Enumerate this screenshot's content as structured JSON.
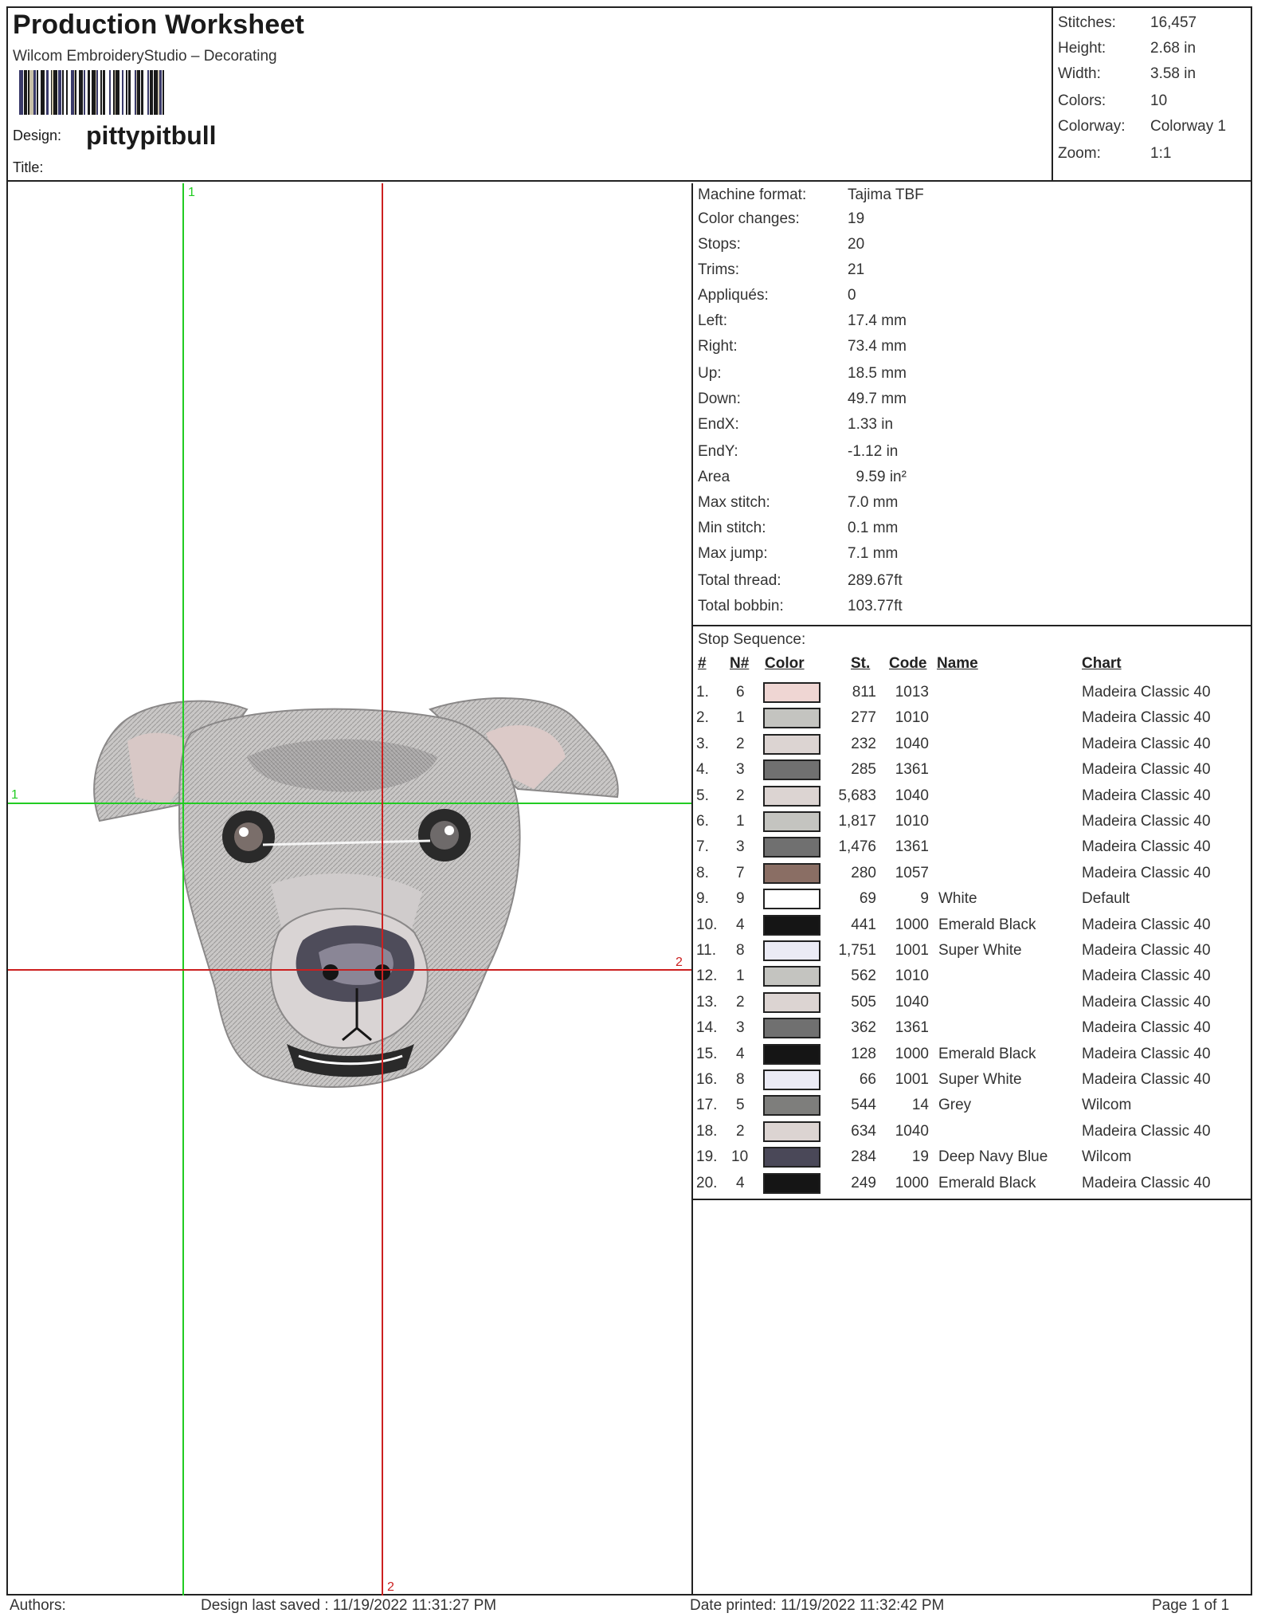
{
  "header": {
    "title": "Production Worksheet",
    "subtitle": "Wilcom EmbroideryStudio – Decorating",
    "design_label": "Design:",
    "design_name": "pittypitbull",
    "title_label": "Title:"
  },
  "summary": [
    {
      "label": "Stitches:",
      "value": "16,457"
    },
    {
      "label": "Height:",
      "value": "2.68 in"
    },
    {
      "label": "Width:",
      "value": "3.58 in"
    },
    {
      "label": "Colors:",
      "value": "10"
    },
    {
      "label": "Colorway:",
      "value": "Colorway 1"
    },
    {
      "label": "Zoom:",
      "value": "1:1"
    }
  ],
  "info": [
    {
      "label": "Machine format:",
      "value": "Tajima TBF"
    },
    {
      "label": "Color changes:",
      "value": "19"
    },
    {
      "label": "Stops:",
      "value": "20"
    },
    {
      "label": "Trims:",
      "value": "21"
    },
    {
      "label": "Appliqués:",
      "value": "0"
    },
    {
      "label": "Left:",
      "value": "17.4 mm"
    },
    {
      "label": "Right:",
      "value": "73.4 mm"
    },
    {
      "label": "Up:",
      "value": "18.5 mm"
    },
    {
      "label": "Down:",
      "value": "49.7 mm"
    },
    {
      "label": "EndX:",
      "value": "1.33 in"
    },
    {
      "label": "EndY:",
      "value": "-1.12 in"
    },
    {
      "label": "Area",
      "value": "  9.59 in²"
    },
    {
      "label": "Max stitch:",
      "value": "7.0 mm"
    },
    {
      "label": "Min stitch:",
      "value": "0.1 mm"
    },
    {
      "label": "Max jump:",
      "value": "7.1 mm"
    },
    {
      "label": "Total thread:",
      "value": "289.67ft"
    },
    {
      "label": "Total bobbin:",
      "value": "103.77ft"
    }
  ],
  "sequence": {
    "title": "Stop Sequence:",
    "headers": {
      "num": "#",
      "n": "N#",
      "color": "Color",
      "st": "St.",
      "code": "Code",
      "name": "Name",
      "chart": "Chart"
    },
    "rows": [
      {
        "num": "1.",
        "n": "6",
        "color": "#efd6d3",
        "st": "811",
        "code": "1013",
        "name": "",
        "chart": "Madeira Classic 40"
      },
      {
        "num": "2.",
        "n": "1",
        "color": "#c4c4c0",
        "st": "277",
        "code": "1010",
        "name": "",
        "chart": "Madeira Classic 40"
      },
      {
        "num": "3.",
        "n": "2",
        "color": "#dcd4d2",
        "st": "232",
        "code": "1040",
        "name": "",
        "chart": "Madeira Classic 40"
      },
      {
        "num": "4.",
        "n": "3",
        "color": "#707070",
        "st": "285",
        "code": "1361",
        "name": "",
        "chart": "Madeira Classic 40"
      },
      {
        "num": "5.",
        "n": "2",
        "color": "#dcd4d2",
        "st": "5,683",
        "code": "1040",
        "name": "",
        "chart": "Madeira Classic 40"
      },
      {
        "num": "6.",
        "n": "1",
        "color": "#c4c4c0",
        "st": "1,817",
        "code": "1010",
        "name": "",
        "chart": "Madeira Classic 40"
      },
      {
        "num": "7.",
        "n": "3",
        "color": "#707070",
        "st": "1,476",
        "code": "1361",
        "name": "",
        "chart": "Madeira Classic 40"
      },
      {
        "num": "8.",
        "n": "7",
        "color": "#8a6e64",
        "st": "280",
        "code": "1057",
        "name": "",
        "chart": "Madeira Classic 40"
      },
      {
        "num": "9.",
        "n": "9",
        "color": "#ffffff",
        "st": "69",
        "code": "9",
        "name": "White",
        "chart": "Default"
      },
      {
        "num": "10.",
        "n": "4",
        "color": "#151515",
        "st": "441",
        "code": "1000",
        "name": "Emerald Black",
        "chart": "Madeira Classic 40"
      },
      {
        "num": "11.",
        "n": "8",
        "color": "#ebebf5",
        "st": "1,751",
        "code": "1001",
        "name": "Super White",
        "chart": "Madeira Classic 40"
      },
      {
        "num": "12.",
        "n": "1",
        "color": "#c4c4c0",
        "st": "562",
        "code": "1010",
        "name": "",
        "chart": "Madeira Classic 40"
      },
      {
        "num": "13.",
        "n": "2",
        "color": "#dcd4d2",
        "st": "505",
        "code": "1040",
        "name": "",
        "chart": "Madeira Classic 40"
      },
      {
        "num": "14.",
        "n": "3",
        "color": "#707070",
        "st": "362",
        "code": "1361",
        "name": "",
        "chart": "Madeira Classic 40"
      },
      {
        "num": "15.",
        "n": "4",
        "color": "#151515",
        "st": "128",
        "code": "1000",
        "name": "Emerald Black",
        "chart": "Madeira Classic 40"
      },
      {
        "num": "16.",
        "n": "8",
        "color": "#ebebf5",
        "st": "66",
        "code": "1001",
        "name": "Super White",
        "chart": "Madeira Classic 40"
      },
      {
        "num": "17.",
        "n": "5",
        "color": "#7e7e7c",
        "st": "544",
        "code": "14",
        "name": "Grey",
        "chart": "Wilcom"
      },
      {
        "num": "18.",
        "n": "2",
        "color": "#dcd4d2",
        "st": "634",
        "code": "1040",
        "name": "",
        "chart": "Madeira Classic 40"
      },
      {
        "num": "19.",
        "n": "10",
        "color": "#4a4858",
        "st": "284",
        "code": "19",
        "name": "Deep Navy Blue",
        "chart": "Wilcom"
      },
      {
        "num": "20.",
        "n": "4",
        "color": "#151515",
        "st": "249",
        "code": "1000",
        "name": "Emerald Black",
        "chart": "Madeira Classic 40"
      }
    ]
  },
  "guides": {
    "v1_label": "1",
    "h1_label": "1",
    "h2_label": "2",
    "v2_label": "2",
    "green": "#22cc22",
    "red": "#cc2020"
  },
  "footer": {
    "authors": "Authors:",
    "saved": "Design last saved : 11/19/2022 11:31:27 PM",
    "printed": "Date printed: 11/19/2022 11:32:42 PM",
    "page": "Page 1 of 1"
  }
}
